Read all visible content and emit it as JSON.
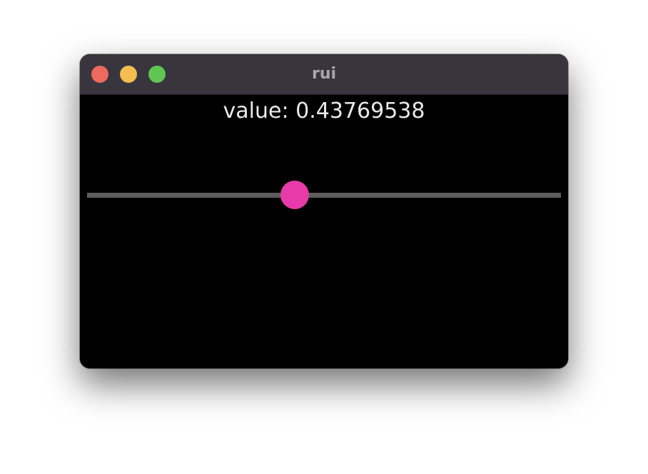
{
  "window": {
    "title": "rui"
  },
  "controls": {
    "close_color": "#ec6a5e",
    "minimize_color": "#f4bf4f",
    "maximize_color": "#61c554"
  },
  "content": {
    "value_label": "value: 0.43769538"
  },
  "slider": {
    "value": 0.43769538,
    "track_color": "#5c5c5c",
    "thumb_color": "#e83aa9"
  }
}
